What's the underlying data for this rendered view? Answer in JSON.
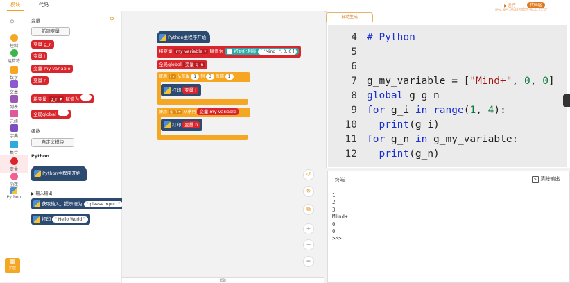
{
  "tabs": {
    "blocks": "模块",
    "code": "代码"
  },
  "header": {
    "run": "运行",
    "code_area": "代码区",
    "brand": "DF创客社区"
  },
  "categories": [
    {
      "label": "控制",
      "color": "#f5a623",
      "shape": "dot"
    },
    {
      "label": "运算符",
      "color": "#3cb54a",
      "shape": "dot"
    },
    {
      "label": "数字",
      "color": "#f5a623",
      "shape": "sq"
    },
    {
      "label": "文本",
      "color": "#8b5bd0",
      "shape": "sq"
    },
    {
      "label": "列表",
      "color": "#9b59b6",
      "shape": "sq"
    },
    {
      "label": "元组",
      "color": "#e05a9a",
      "shape": "sq"
    },
    {
      "label": "字典",
      "color": "#7a4fc0",
      "shape": "sq"
    },
    {
      "label": "集合",
      "color": "#2eaadc",
      "shape": "sq"
    },
    {
      "label": "变量",
      "color": "#d8262c",
      "shape": "dot"
    },
    {
      "label": "函数",
      "color": "#f06292",
      "shape": "dot"
    },
    {
      "label": "Python",
      "color": "#4a8cd8",
      "shape": "py"
    }
  ],
  "extend": "扩展",
  "palette": {
    "var_title": "变量",
    "new_var": "新建变量",
    "vars": [
      "变量 g_n",
      "变量 i",
      "变量 my variable",
      "变量 n"
    ],
    "assign": {
      "label": "将变量",
      "var": "g_n ▾",
      "to": "赋值为"
    },
    "global": "全局global",
    "func_title": "函数",
    "custom_block": "自定义模块",
    "py_title": "Python",
    "py_start": "Python主程序开始",
    "io_title": "输入输出",
    "input_label": "获取输入，提示语为",
    "input_value": "\" please input: \"",
    "print_label": "打印",
    "print_value": "\" Hello World \""
  },
  "workspace": {
    "start": "Python主程序开始",
    "set_label": "将变量",
    "set_var": "my variable ▾",
    "set_to": "赋值为",
    "list_init": "初始化列表",
    "list_value": "[ \"Mind+\", 0, 0 ]",
    "global_label": "全局global",
    "global_var": "变量 g_n",
    "for1_use": "使用",
    "for1_var": "i ▾",
    "for1_from": "从范围",
    "for1_start": "1",
    "for1_to": "到",
    "for1_end": "3",
    "for1_step_label": "每隔",
    "for1_step": "1",
    "print1": "打印",
    "print1_var": "变量 i",
    "for2_use": "使用",
    "for2_var": "g_n ▾",
    "for2_from": "从序列",
    "for2_seq": "变量 my variable",
    "print2": "打印",
    "print2_var": "变量 n",
    "bottom_label": "帮助"
  },
  "code_tab": "自动生成",
  "code_lines": [
    {
      "n": "4",
      "html": "<span class='cm'># Python</span>"
    },
    {
      "n": "5",
      "html": ""
    },
    {
      "n": "6",
      "html": ""
    },
    {
      "n": "7",
      "html": "g_my_variable = [<span class='str'>\"Mind+\"</span>, <span class='num'>0</span>, <span class='num'>0</span>]"
    },
    {
      "n": "8",
      "html": "<span class='kw'>global</span> g_g_n"
    },
    {
      "n": "9",
      "html": "<span class='kw'>for</span> g_i <span class='kw'>in</span> <span class='kw'>range</span>(<span class='num'>1</span>, <span class='num'>4</span>):"
    },
    {
      "n": "10",
      "html": "  <span class='kw'>print</span>(g_i)"
    },
    {
      "n": "11",
      "html": "<span class='kw'>for</span> g_n <span class='kw'>in</span> g_my_variable:"
    },
    {
      "n": "12",
      "html": "  <span class='kw'>print</span>(g_n)"
    }
  ],
  "terminal": {
    "title": "终端",
    "clear": "清除输出",
    "output": [
      "1",
      "2",
      "3",
      "Mind+",
      "0",
      "0",
      ">>>_"
    ]
  }
}
